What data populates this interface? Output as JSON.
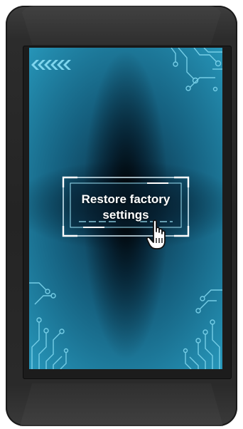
{
  "screen": {
    "button": {
      "label": "Restore factory\nsettings"
    }
  },
  "colors": {
    "screen_edge": "#2aa0c4",
    "screen_mid": "#15607f",
    "circuit_trace": "#7fd6ee",
    "frame": "#dff6ff",
    "device_body": "#2a2a2a"
  },
  "icons": {
    "chevrons": "chevrons-left-icon",
    "pointer": "hand-pointer-icon",
    "circuits": "circuit-trace-icon"
  }
}
